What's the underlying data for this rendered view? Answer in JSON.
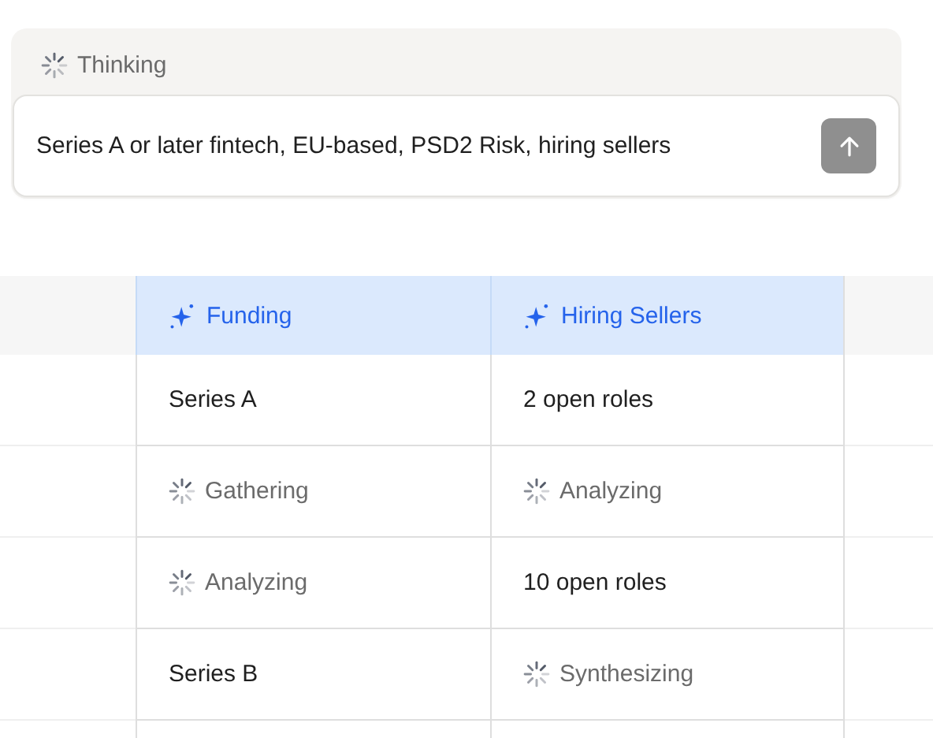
{
  "status": {
    "text": "Thinking",
    "loading": true
  },
  "prompt": {
    "value": "Series A or later fintech, EU-based, PSD2 Risk, hiring sellers"
  },
  "table": {
    "columns": [
      {
        "label": "Funding"
      },
      {
        "label": "Hiring Sellers"
      }
    ],
    "rows": [
      [
        {
          "kind": "value",
          "text": "Series A"
        },
        {
          "kind": "value",
          "text": "2 open roles"
        }
      ],
      [
        {
          "kind": "pending",
          "text": "Gathering"
        },
        {
          "kind": "pending",
          "text": "Analyzing"
        }
      ],
      [
        {
          "kind": "pending",
          "text": "Analyzing"
        },
        {
          "kind": "value",
          "text": "10 open roles"
        }
      ],
      [
        {
          "kind": "value",
          "text": "Series B"
        },
        {
          "kind": "pending",
          "text": "Synthesizing"
        }
      ]
    ]
  }
}
